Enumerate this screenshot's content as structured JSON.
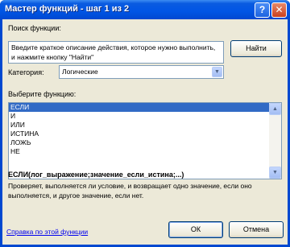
{
  "window": {
    "title": "Мастер функций - шаг 1 из 2",
    "help_button": "?",
    "close_button": "✕"
  },
  "search": {
    "label": "Поиск функции:",
    "value": "Введите краткое описание действия, которое нужно выполнить, и нажмите кнопку \"Найти\"",
    "find_button": "Найти"
  },
  "category": {
    "label": "Категория:",
    "selected": "Логические"
  },
  "functions": {
    "label": "Выберите функцию:",
    "items": [
      "ЕСЛИ",
      "И",
      "ИЛИ",
      "ИСТИНА",
      "ЛОЖЬ",
      "НЕ"
    ],
    "selected_index": 0
  },
  "syntax": "ЕСЛИ(лог_выражение;значение_если_истина;...)",
  "description": "Проверяет, выполняется ли условие, и возвращает одно значение, если оно выполняется, и другое значение, если нет.",
  "footer": {
    "help_link": "Справка по этой функции",
    "ok_button": "ОК",
    "cancel_button": "Отмена"
  }
}
